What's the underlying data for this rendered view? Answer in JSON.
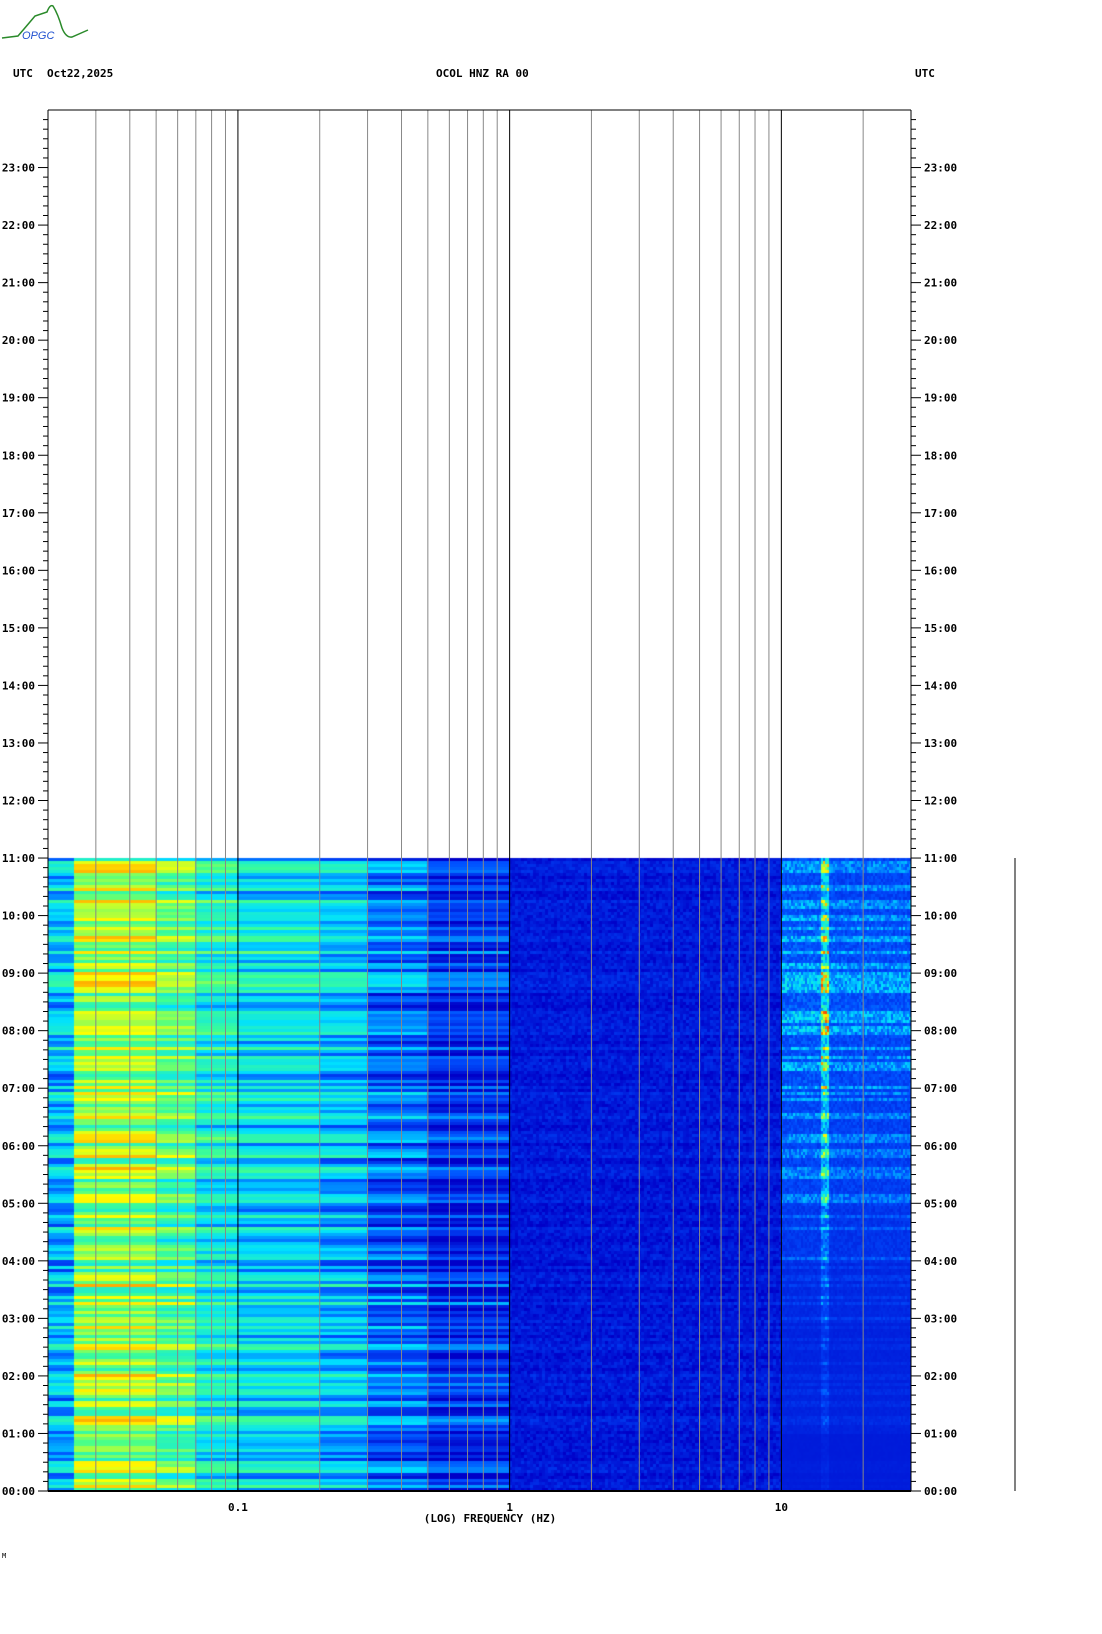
{
  "header": {
    "logo_text": "OPGC",
    "left_timezone": "UTC",
    "date": "Oct22,2025",
    "station": "OCOL HNZ RA 00",
    "right_timezone": "UTC"
  },
  "footer_mark": "M",
  "chart_data": {
    "type": "heatmap",
    "title": "OCOL HNZ RA 00",
    "xlabel": "(LOG) FREQUENCY (HZ)",
    "ylabel": "UTC",
    "x_scale": "log",
    "xlim": [
      0.02,
      30
    ],
    "x_ticks": [
      0.1,
      1,
      10
    ],
    "x_tick_labels": [
      "0.1",
      "1",
      "10"
    ],
    "ylim_hours": [
      0,
      24
    ],
    "y_tick_labels": [
      "00:00",
      "01:00",
      "02:00",
      "03:00",
      "04:00",
      "05:00",
      "06:00",
      "07:00",
      "08:00",
      "09:00",
      "10:00",
      "11:00",
      "12:00",
      "13:00",
      "14:00",
      "15:00",
      "16:00",
      "17:00",
      "18:00",
      "19:00",
      "20:00",
      "21:00",
      "22:00",
      "23:00"
    ],
    "data_end_hour": 11,
    "grid": "vertical log grid lines",
    "colormap": [
      "#0000c8",
      "#0050ff",
      "#00e0ff",
      "#40ff90",
      "#ffff00",
      "#ff6000",
      "#c00000"
    ],
    "freq_bins_hz": [
      0.02,
      0.025,
      0.05,
      0.07,
      0.1,
      0.2,
      0.3,
      0.5,
      1,
      10,
      14,
      15,
      30
    ],
    "mean_intensity_by_bin": [
      0.3,
      0.58,
      0.5,
      0.4,
      0.35,
      0.3,
      0.2,
      0.1,
      0.05,
      0.18,
      0.45,
      0.16
    ],
    "hf_activity_by_hour": [
      0.05,
      0.15,
      0.15,
      0.25,
      0.45,
      0.6,
      0.65,
      0.75,
      0.85,
      0.8,
      0.7
    ]
  }
}
